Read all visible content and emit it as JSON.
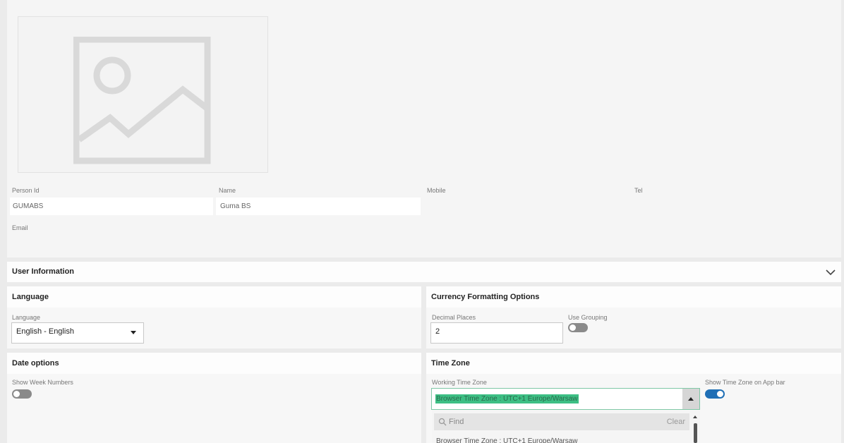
{
  "profile": {
    "image_icon": "image-placeholder-icon",
    "fields": {
      "person_id": {
        "label": "Person Id",
        "value": "GUMABS"
      },
      "name": {
        "label": "Name",
        "value": "Guma BS"
      },
      "mobile": {
        "label": "Mobile",
        "value": ""
      },
      "tel": {
        "label": "Tel",
        "value": ""
      },
      "email": {
        "label": "Email",
        "value": ""
      }
    }
  },
  "user_information": {
    "title": "User Information",
    "icon": "chevron-down-icon"
  },
  "language": {
    "title": "Language",
    "field_label": "Language",
    "selected": "English - English",
    "icon": "caret-down-icon"
  },
  "currency": {
    "title": "Currency Formatting Options",
    "decimal_label": "Decimal Places",
    "decimal_value": "2",
    "grouping_label": "Use Grouping",
    "grouping_on": false
  },
  "date_options": {
    "title": "Date options",
    "week_numbers_label": "Show Week Numbers",
    "week_numbers_on": false
  },
  "time_zone": {
    "title": "Time Zone",
    "working_label": "Working Time Zone",
    "selected": "Browser Time Zone : UTC+1 Europe/Warsaw",
    "highlight_color": "#3dbf84",
    "show_label": "Show Time Zone on App bar",
    "show_on": true,
    "find_placeholder": "Find",
    "clear_label": "Clear",
    "next_option": "Browser Time Zone : UTC+1 Europe/Warsaw"
  }
}
